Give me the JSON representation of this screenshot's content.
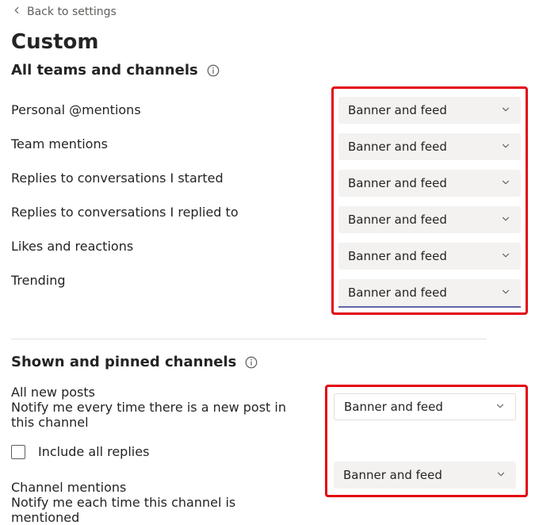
{
  "back_label": "Back to settings",
  "page_title": "Custom",
  "section1": {
    "title": "All teams and channels",
    "items": [
      {
        "label": "Personal @mentions",
        "value": "Banner and feed"
      },
      {
        "label": "Team mentions",
        "value": "Banner and feed"
      },
      {
        "label": "Replies to conversations I started",
        "value": "Banner and feed"
      },
      {
        "label": "Replies to conversations I replied to",
        "value": "Banner and feed"
      },
      {
        "label": "Likes and reactions",
        "value": "Banner and feed"
      },
      {
        "label": "Trending",
        "value": "Banner and feed"
      }
    ]
  },
  "section2": {
    "title": "Shown and pinned channels",
    "all_new_posts": {
      "label": "All new posts",
      "sub": "Notify me every time there is a new post in this channel",
      "value": "Banner and feed"
    },
    "include_all_replies": {
      "label": "Include all replies",
      "checked": false
    },
    "channel_mentions": {
      "label": "Channel mentions",
      "sub": "Notify me each time this channel is mentioned",
      "value": "Banner and feed"
    }
  },
  "colors": {
    "highlight": "#e30613",
    "accent": "#6264a7"
  }
}
